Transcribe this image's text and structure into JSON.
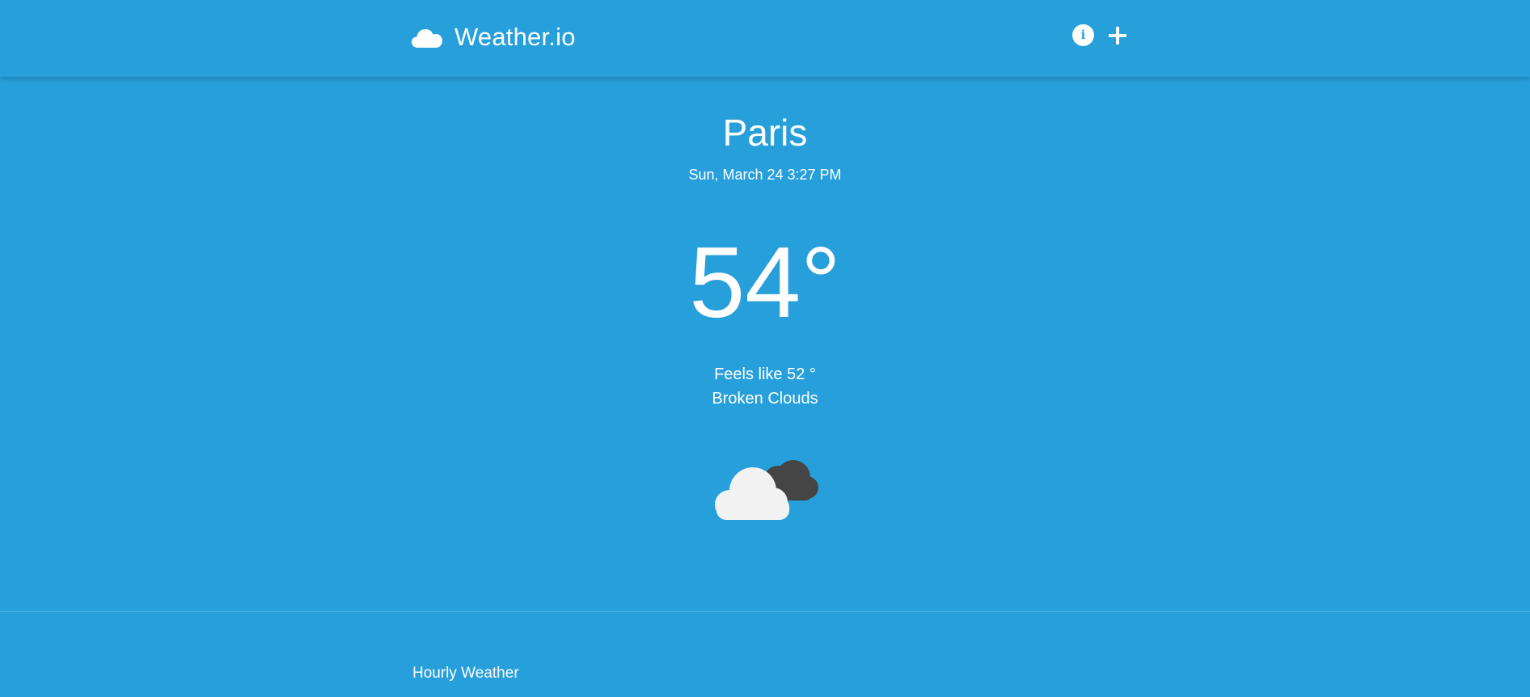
{
  "header": {
    "app_title": "Weather.io",
    "logo_icon": "cloud-icon",
    "info_icon": "info-icon",
    "add_icon": "plus-icon"
  },
  "current": {
    "city": "Paris",
    "datetime": "Sun, March 24 3:27 PM",
    "temperature": "54°",
    "feels_like": "Feels like 52 °",
    "condition": "Broken Clouds",
    "condition_icon": "broken-clouds-icon"
  },
  "hourly": {
    "title": "Hourly Weather"
  },
  "colors": {
    "background": "#279fda",
    "text": "#ffffff",
    "light_cloud": "#f2f2f2",
    "dark_cloud": "#454545"
  }
}
